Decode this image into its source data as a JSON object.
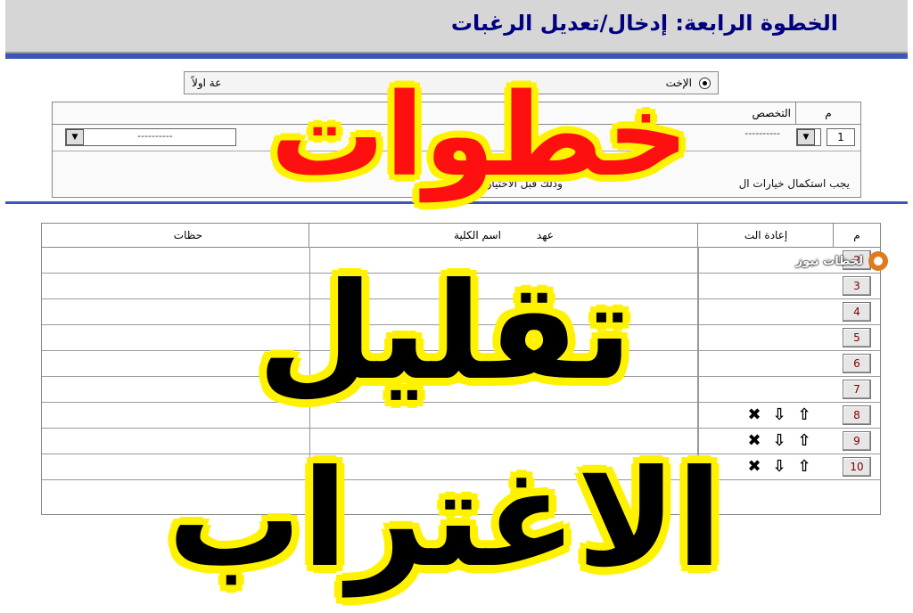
{
  "header": {
    "step_title": "الخطوة الرابعة: إدخال/تعديل الرغبات"
  },
  "radio_row": {
    "label_right": "الإخت",
    "label_left": "عة اولاً"
  },
  "spec_table": {
    "col_m": "م",
    "col_spec": "التخصص",
    "row_number": "1",
    "dashes": "----------",
    "note_right": "يجب استكمال خيارات ال",
    "note_left": "وذلك قبل الاختيارات الحرة"
  },
  "choices_table": {
    "col_m": "م",
    "col_reorder": "إعادة الت",
    "col_college": "اسم الكلية",
    "col_college_tail": "عهد",
    "col_notes": "حظات",
    "rows": [
      {
        "num": "2"
      },
      {
        "num": "3"
      },
      {
        "num": "4"
      },
      {
        "num": "5"
      },
      {
        "num": "6"
      },
      {
        "num": "7"
      },
      {
        "num": "8",
        "icons": [
          "✖",
          "⇩",
          "⇧"
        ]
      },
      {
        "num": "9",
        "icons": [
          "✖",
          "⇩",
          "⇧"
        ]
      },
      {
        "num": "10",
        "icons": [
          "✖",
          "⇩",
          "⇧"
        ]
      }
    ],
    "icon_names": [
      "delete-icon",
      "move-down-icon",
      "move-up-icon"
    ]
  },
  "overlay": {
    "title": "خطوات",
    "subtitle": "تقليل الاغتراب",
    "title_color": "#ff1010",
    "outline_color": "#fff200"
  },
  "watermark": {
    "text": "لحظات نيوز"
  },
  "colors": {
    "accent": "#3b56b8",
    "title_text": "#000080"
  }
}
